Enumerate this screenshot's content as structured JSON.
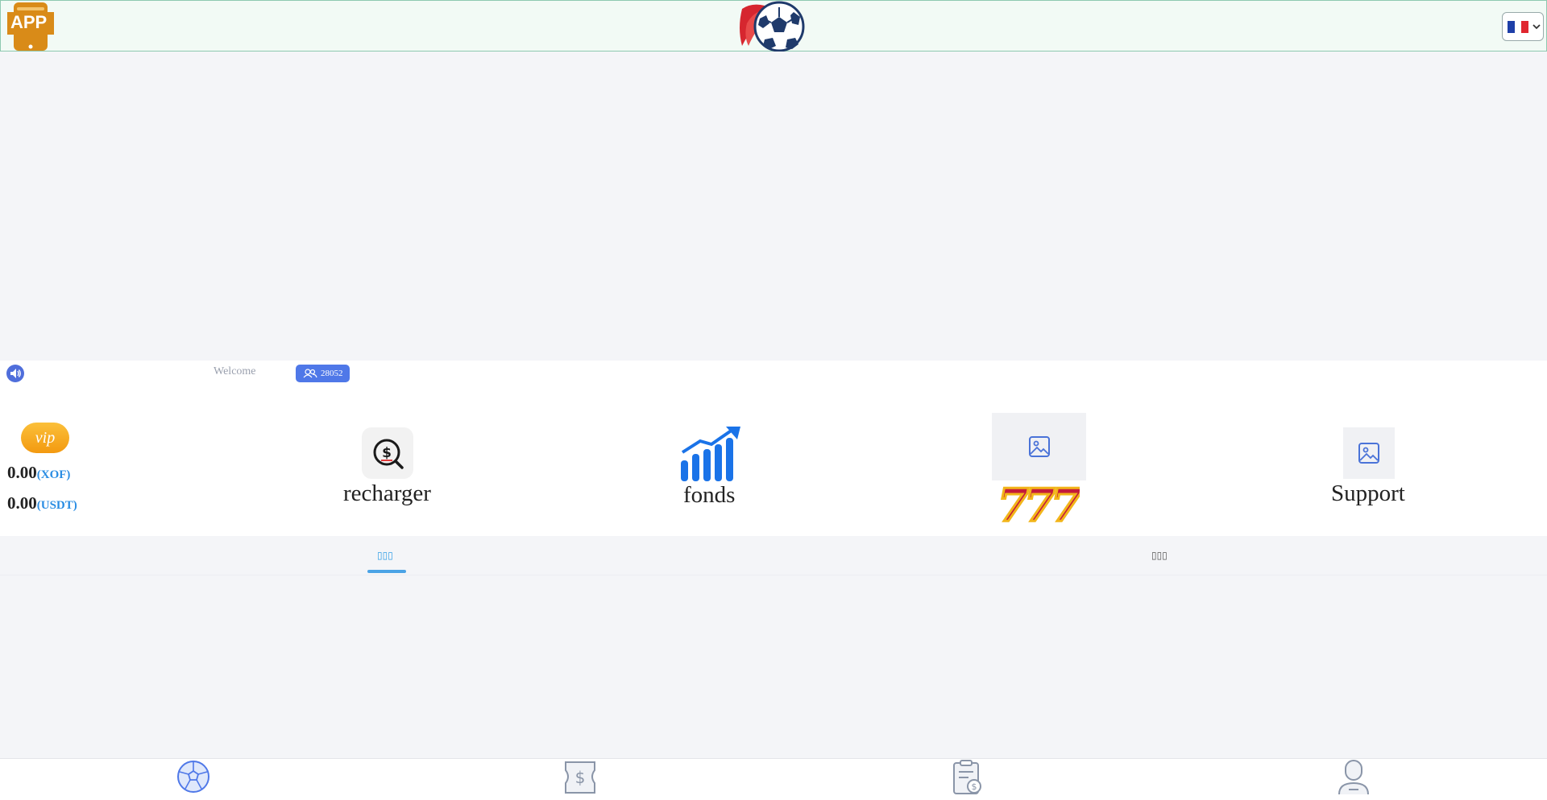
{
  "header": {
    "app_icon_label": "APP",
    "logo_icon": "soccer-ball-logo-icon",
    "language_flag": "flag-fr-icon",
    "colors": {
      "header_bg": "#f2faf5",
      "header_border": "#8ec9b0",
      "app_icon": "#d98b18"
    }
  },
  "notice": {
    "welcome_text": "Welcome",
    "online_count": "28052"
  },
  "panel": {
    "vip_label": "vip",
    "balances": [
      {
        "amount": "0.00",
        "currency": "(XOF)"
      },
      {
        "amount": "0.00",
        "currency": "(USDT)"
      }
    ],
    "tiles": [
      {
        "label": "recharger",
        "icon": "dollar-search-icon"
      },
      {
        "label": "fonds",
        "icon": "growth-chart-icon"
      },
      {
        "label": "",
        "icon": "slot-777-icon"
      },
      {
        "label": "Support",
        "icon": "image-placeholder-icon"
      }
    ]
  },
  "tabs": [
    {
      "label": "▯▯▯",
      "active": true
    },
    {
      "label": "▯▯▯",
      "active": false
    }
  ],
  "bottom_nav": [
    {
      "icon": "soccer-ball-icon",
      "active": true
    },
    {
      "icon": "dollar-ticket-icon",
      "active": false
    },
    {
      "icon": "clipboard-dollar-icon",
      "active": false
    },
    {
      "icon": "user-icon",
      "active": false
    }
  ],
  "colors": {
    "accent": "#4f78e8",
    "vip": "#f5a623",
    "currency": "#2a8de3"
  }
}
